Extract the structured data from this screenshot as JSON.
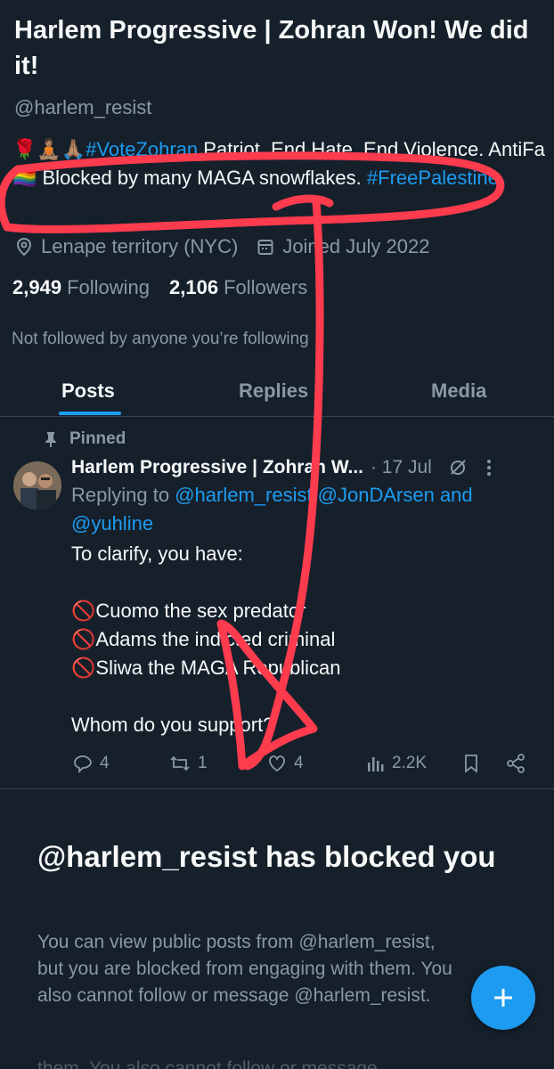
{
  "profile": {
    "display_name": "Harlem Progressive | Zohran Won! We did it!",
    "handle": "@harlem_resist",
    "bio_emoji": "🌹🧘🏽🙏🏽",
    "bio_hashtag1": "#VoteZohran",
    "bio_text1": " Patriot. End Hate. End Violence. AntiFa 🏳️‍🌈 Blocked by many MAGA snowflakes. ",
    "bio_hashtag2": "#FreePalestine",
    "location": "Lenape territory (NYC)",
    "joined": "Joined July 2022",
    "following_count": "2,949",
    "following_label": "Following",
    "followers_count": "2,106",
    "followers_label": "Followers",
    "not_followed": "Not followed by anyone you’re following"
  },
  "tabs": [
    {
      "label": "Posts"
    },
    {
      "label": "Replies"
    },
    {
      "label": "Media"
    }
  ],
  "tweet": {
    "pinned_label": "Pinned",
    "author": "Harlem Progressive | Zohran W...",
    "date": "· 17 Jul",
    "replying_prefix": "Replying to ",
    "replying_handles": "@harlem_resist @JonDArsen and @yuhline",
    "body": "To clarify, you have:\n\n🚫Cuomo the sex predator\n🚫Adams the indicted criminal\n🚫Sliwa the MAGA Republican\n\nWhom do you support?",
    "replies": "4",
    "reposts": "1",
    "likes": "4",
    "views": "2.2K"
  },
  "blocked": {
    "title": "@harlem_resist has blocked you",
    "description": "You can view public posts from @harlem_resist, but you are blocked from engaging with them. You also cannot follow or message @harlem_resist.",
    "ghost_text": "them. You also cannot follow or message"
  },
  "colors": {
    "background": "#15202b",
    "accent": "#1d9bf0",
    "annotation": "#ff3b4e"
  },
  "icons": [
    "location-icon",
    "calendar-icon",
    "pin-icon",
    "edit-icon",
    "more-icon",
    "reply-icon",
    "repost-icon",
    "like-icon",
    "views-icon",
    "bookmark-icon",
    "share-icon",
    "plus-icon"
  ]
}
